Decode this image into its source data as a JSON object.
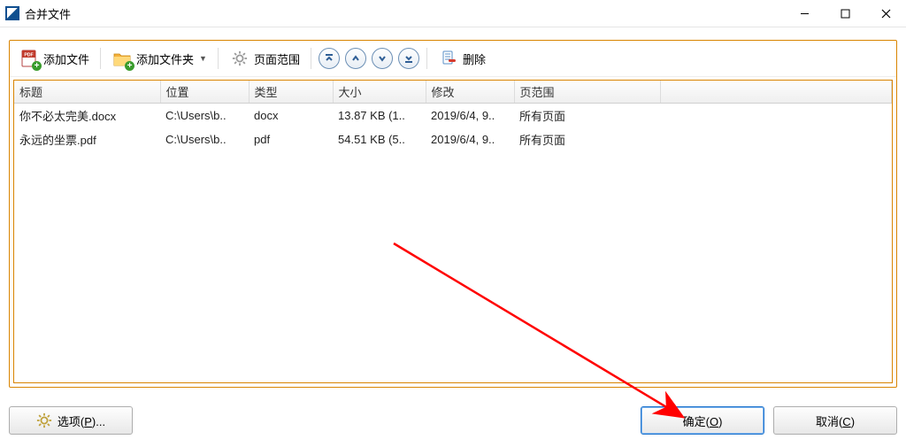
{
  "window": {
    "title": "合并文件"
  },
  "toolbar": {
    "add_file": "添加文件",
    "add_folder": "添加文件夹",
    "page_range": "页面范围",
    "delete": "删除"
  },
  "columns": {
    "title": "标题",
    "location": "位置",
    "type": "类型",
    "size": "大小",
    "modified": "修改",
    "page_range": "页范围"
  },
  "rows": [
    {
      "title": "你不必太完美.docx",
      "location": "C:\\Users\\b..",
      "type": "docx",
      "size": "13.87 KB (1..",
      "modified": "2019/6/4, 9..",
      "page_range": "所有页面"
    },
    {
      "title": "永远的坐票.pdf",
      "location": "C:\\Users\\b..",
      "type": "pdf",
      "size": "54.51 KB (5..",
      "modified": "2019/6/4, 9..",
      "page_range": "所有页面"
    }
  ],
  "buttons": {
    "options_pre": "选项(",
    "options_key": "P",
    "options_post": ")...",
    "ok_pre": "确定(",
    "ok_key": "O",
    "ok_post": ")",
    "cancel_pre": "取消(",
    "cancel_key": "C",
    "cancel_post": ")"
  }
}
